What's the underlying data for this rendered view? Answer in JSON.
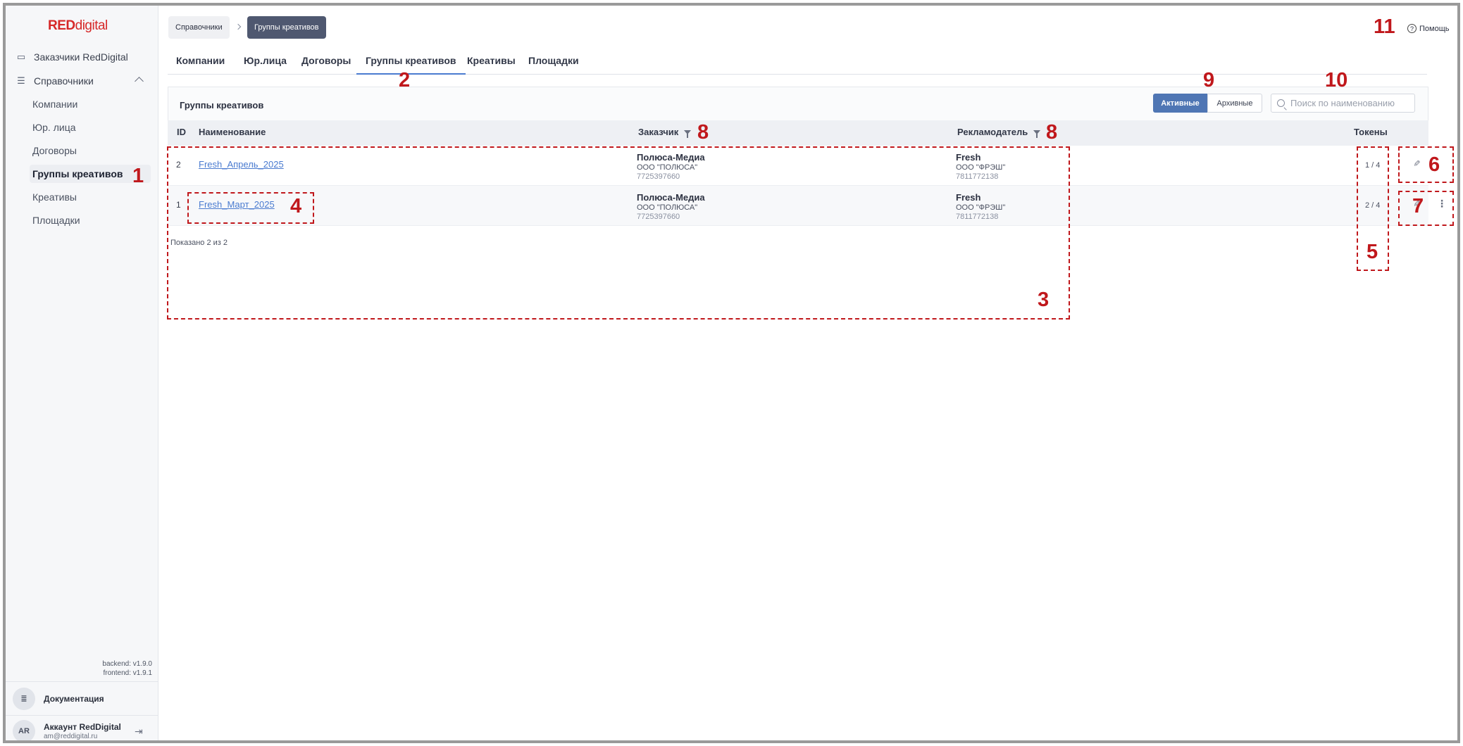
{
  "logo": {
    "red": "RED",
    "digital": "digital"
  },
  "sidebar": {
    "top_item": "Заказчики RedDigital",
    "section": "Справочники",
    "items": [
      "Компании",
      "Юр. лица",
      "Договоры",
      "Группы креативов",
      "Креативы",
      "Площадки"
    ],
    "versions": {
      "backend": "backend: v1.9.0",
      "frontend": "frontend: v1.9.1"
    },
    "docs_label": "Документация",
    "account": {
      "initials": "AR",
      "name": "Аккаунт RedDigital",
      "email": "am@reddigital.ru"
    }
  },
  "breadcrumb": {
    "parent": "Справочники",
    "current": "Группы креативов"
  },
  "help_label": "Помощь",
  "tabs": [
    "Компании",
    "Юр.лица",
    "Договоры",
    "Группы креативов",
    "Креативы",
    "Площадки"
  ],
  "panel": {
    "title": "Группы креативов",
    "toggle_active": "Активные",
    "toggle_archive": "Архивные",
    "search_placeholder": "Поиск по наименованию"
  },
  "table": {
    "headers": {
      "id": "ID",
      "name": "Наименование",
      "customer": "Заказчик",
      "advertiser": "Рекламодатель",
      "tokens": "Токены"
    },
    "rows": [
      {
        "id": "2",
        "name": "Fresh_Апрель_2025",
        "customer": {
          "name": "Полюса-Медиа",
          "legal": "ООО \"ПОЛЮСА\"",
          "inn": "7725397660"
        },
        "advertiser": {
          "name": "Fresh",
          "legal": "ООО \"ФРЭШ\"",
          "inn": "7811772138"
        },
        "tokens": "1 / 4"
      },
      {
        "id": "1",
        "name": "Fresh_Март_2025",
        "customer": {
          "name": "Полюса-Медиа",
          "legal": "ООО \"ПОЛЮСА\"",
          "inn": "7725397660"
        },
        "advertiser": {
          "name": "Fresh",
          "legal": "ООО \"ФРЭШ\"",
          "inn": "7811772138"
        },
        "tokens": "2 / 4"
      }
    ],
    "shown_text": "Показано 2 из 2"
  },
  "annotations": [
    "1",
    "2",
    "3",
    "4",
    "5",
    "6",
    "7",
    "8",
    "8",
    "9",
    "10",
    "11"
  ],
  "colors": {
    "accent": "#4a7bd0",
    "brand": "#d62828",
    "annotation": "#c0181c",
    "toggle_active": "#4f76b4"
  }
}
